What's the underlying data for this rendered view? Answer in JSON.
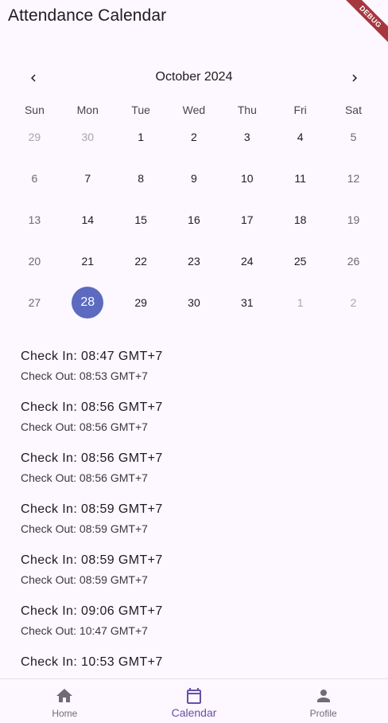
{
  "app": {
    "title": "Attendance Calendar",
    "debug_label": "DEBUG"
  },
  "calendar": {
    "month_label": "October 2024",
    "prev_icon": "chevron-left-icon",
    "next_icon": "chevron-right-icon",
    "weekdays": [
      "Sun",
      "Mon",
      "Tue",
      "Wed",
      "Thu",
      "Fri",
      "Sat"
    ],
    "days": [
      {
        "label": "29",
        "type": "outside"
      },
      {
        "label": "30",
        "type": "outside"
      },
      {
        "label": "1",
        "type": "weekday-day"
      },
      {
        "label": "2",
        "type": "weekday-day"
      },
      {
        "label": "3",
        "type": "weekday-day"
      },
      {
        "label": "4",
        "type": "weekday-day"
      },
      {
        "label": "5",
        "type": "weekend"
      },
      {
        "label": "6",
        "type": "weekend"
      },
      {
        "label": "7",
        "type": "weekday-day"
      },
      {
        "label": "8",
        "type": "weekday-day"
      },
      {
        "label": "9",
        "type": "weekday-day"
      },
      {
        "label": "10",
        "type": "weekday-day"
      },
      {
        "label": "11",
        "type": "weekday-day"
      },
      {
        "label": "12",
        "type": "weekend"
      },
      {
        "label": "13",
        "type": "weekend"
      },
      {
        "label": "14",
        "type": "weekday-day"
      },
      {
        "label": "15",
        "type": "weekday-day"
      },
      {
        "label": "16",
        "type": "weekday-day"
      },
      {
        "label": "17",
        "type": "weekday-day"
      },
      {
        "label": "18",
        "type": "weekday-day"
      },
      {
        "label": "19",
        "type": "weekend"
      },
      {
        "label": "20",
        "type": "weekend"
      },
      {
        "label": "21",
        "type": "weekday-day"
      },
      {
        "label": "22",
        "type": "weekday-day"
      },
      {
        "label": "23",
        "type": "weekday-day"
      },
      {
        "label": "24",
        "type": "weekday-day"
      },
      {
        "label": "25",
        "type": "weekday-day"
      },
      {
        "label": "26",
        "type": "weekend"
      },
      {
        "label": "27",
        "type": "weekend"
      },
      {
        "label": "28",
        "type": "selected"
      },
      {
        "label": "29",
        "type": "weekday-day"
      },
      {
        "label": "30",
        "type": "weekday-day"
      },
      {
        "label": "31",
        "type": "weekday-day"
      },
      {
        "label": "1",
        "type": "outside"
      },
      {
        "label": "2",
        "type": "outside"
      }
    ],
    "selected_day": "28",
    "selected_color": "#5c6bc0"
  },
  "attendance": [
    {
      "check_in": "Check In: 08:47 GMT+7",
      "check_out": "Check Out: 08:53 GMT+7"
    },
    {
      "check_in": "Check In: 08:56 GMT+7",
      "check_out": "Check Out: 08:56 GMT+7"
    },
    {
      "check_in": "Check In: 08:56 GMT+7",
      "check_out": "Check Out: 08:56 GMT+7"
    },
    {
      "check_in": "Check In: 08:59 GMT+7",
      "check_out": "Check Out: 08:59 GMT+7"
    },
    {
      "check_in": "Check In: 08:59 GMT+7",
      "check_out": "Check Out: 08:59 GMT+7"
    },
    {
      "check_in": "Check In: 09:06 GMT+7",
      "check_out": "Check Out: 10:47 GMT+7"
    },
    {
      "check_in": "Check In: 10:53 GMT+7",
      "check_out": ""
    }
  ],
  "bottom_nav": {
    "items": [
      {
        "label": "Home",
        "icon": "home-icon",
        "active": false
      },
      {
        "label": "Calendar",
        "icon": "calendar-icon",
        "active": true
      },
      {
        "label": "Profile",
        "icon": "person-icon",
        "active": false
      }
    ],
    "active_color": "#6750a4",
    "inactive_color": "#6f6c76"
  }
}
